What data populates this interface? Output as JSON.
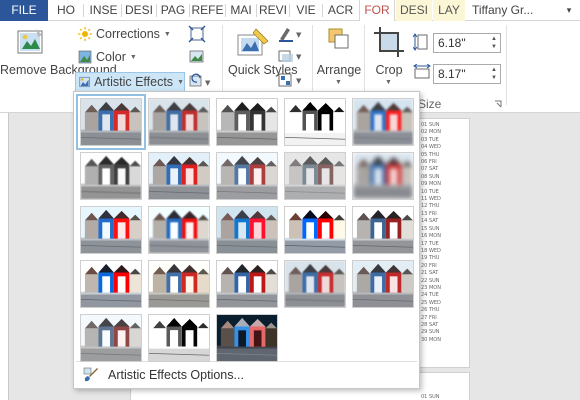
{
  "tabs": [
    {
      "label": "FILE",
      "kind": "file"
    },
    {
      "label": "HO",
      "kind": "normal"
    },
    {
      "label": "INSE",
      "kind": "normal"
    },
    {
      "label": "DESI",
      "kind": "normal"
    },
    {
      "label": "PAG",
      "kind": "normal"
    },
    {
      "label": "REFE",
      "kind": "normal"
    },
    {
      "label": "MAI",
      "kind": "normal"
    },
    {
      "label": "REVI",
      "kind": "normal"
    },
    {
      "label": "VIE",
      "kind": "normal"
    },
    {
      "label": "ACR",
      "kind": "normal"
    },
    {
      "label": "FOR",
      "kind": "active"
    },
    {
      "label": "DESI",
      "kind": "context"
    },
    {
      "label": "LAY",
      "kind": "context"
    }
  ],
  "user": {
    "name": "Tiffany Gr..."
  },
  "ribbon": {
    "remove_background": "Remove Background",
    "corrections": "Corrections",
    "color": "Color",
    "artistic_effects": "Artistic Effects",
    "quick_styles": "Quick Styles",
    "arrange": "Arrange",
    "crop": "Crop",
    "height": "6.18\"",
    "width": "8.17\"",
    "size_group": "Size"
  },
  "gallery": {
    "effects_count": 23,
    "options_label": "Artistic Effects Options..."
  },
  "calendar": {
    "days": [
      "01 SUN",
      "02 MON",
      "03 TUE",
      "04 WED",
      "05 THU",
      "06 FRI",
      "07 SAT",
      "08 SUN",
      "09 MON",
      "10 TUE",
      "11 WED",
      "12 THU",
      "13 FRI",
      "14 SAT",
      "15 SUN",
      "16 MON",
      "17 TUE",
      "18 WED",
      "19 THU",
      "20 FRI",
      "21 SAT",
      "22 SUN",
      "23 MON",
      "24 TUE",
      "25 WED",
      "26 THU",
      "27 FRI",
      "28 SAT",
      "29 SUN",
      "30 MON"
    ],
    "next_page_first": "01 SUN"
  },
  "colors": {
    "file_tab": "#2b579a",
    "active_tab_text": "#c0504d",
    "context_tab": "#fbf6d6",
    "accent_blue": "#2b579a",
    "hut_red": "#d42a2a",
    "hut_blue": "#3b6fb0"
  },
  "icons": {
    "remove_background": "remove-background-icon",
    "corrections": "sun-icon",
    "color": "color-icon",
    "artistic_effects": "artistic-effects-icon",
    "options": "paintbrush-icon"
  }
}
